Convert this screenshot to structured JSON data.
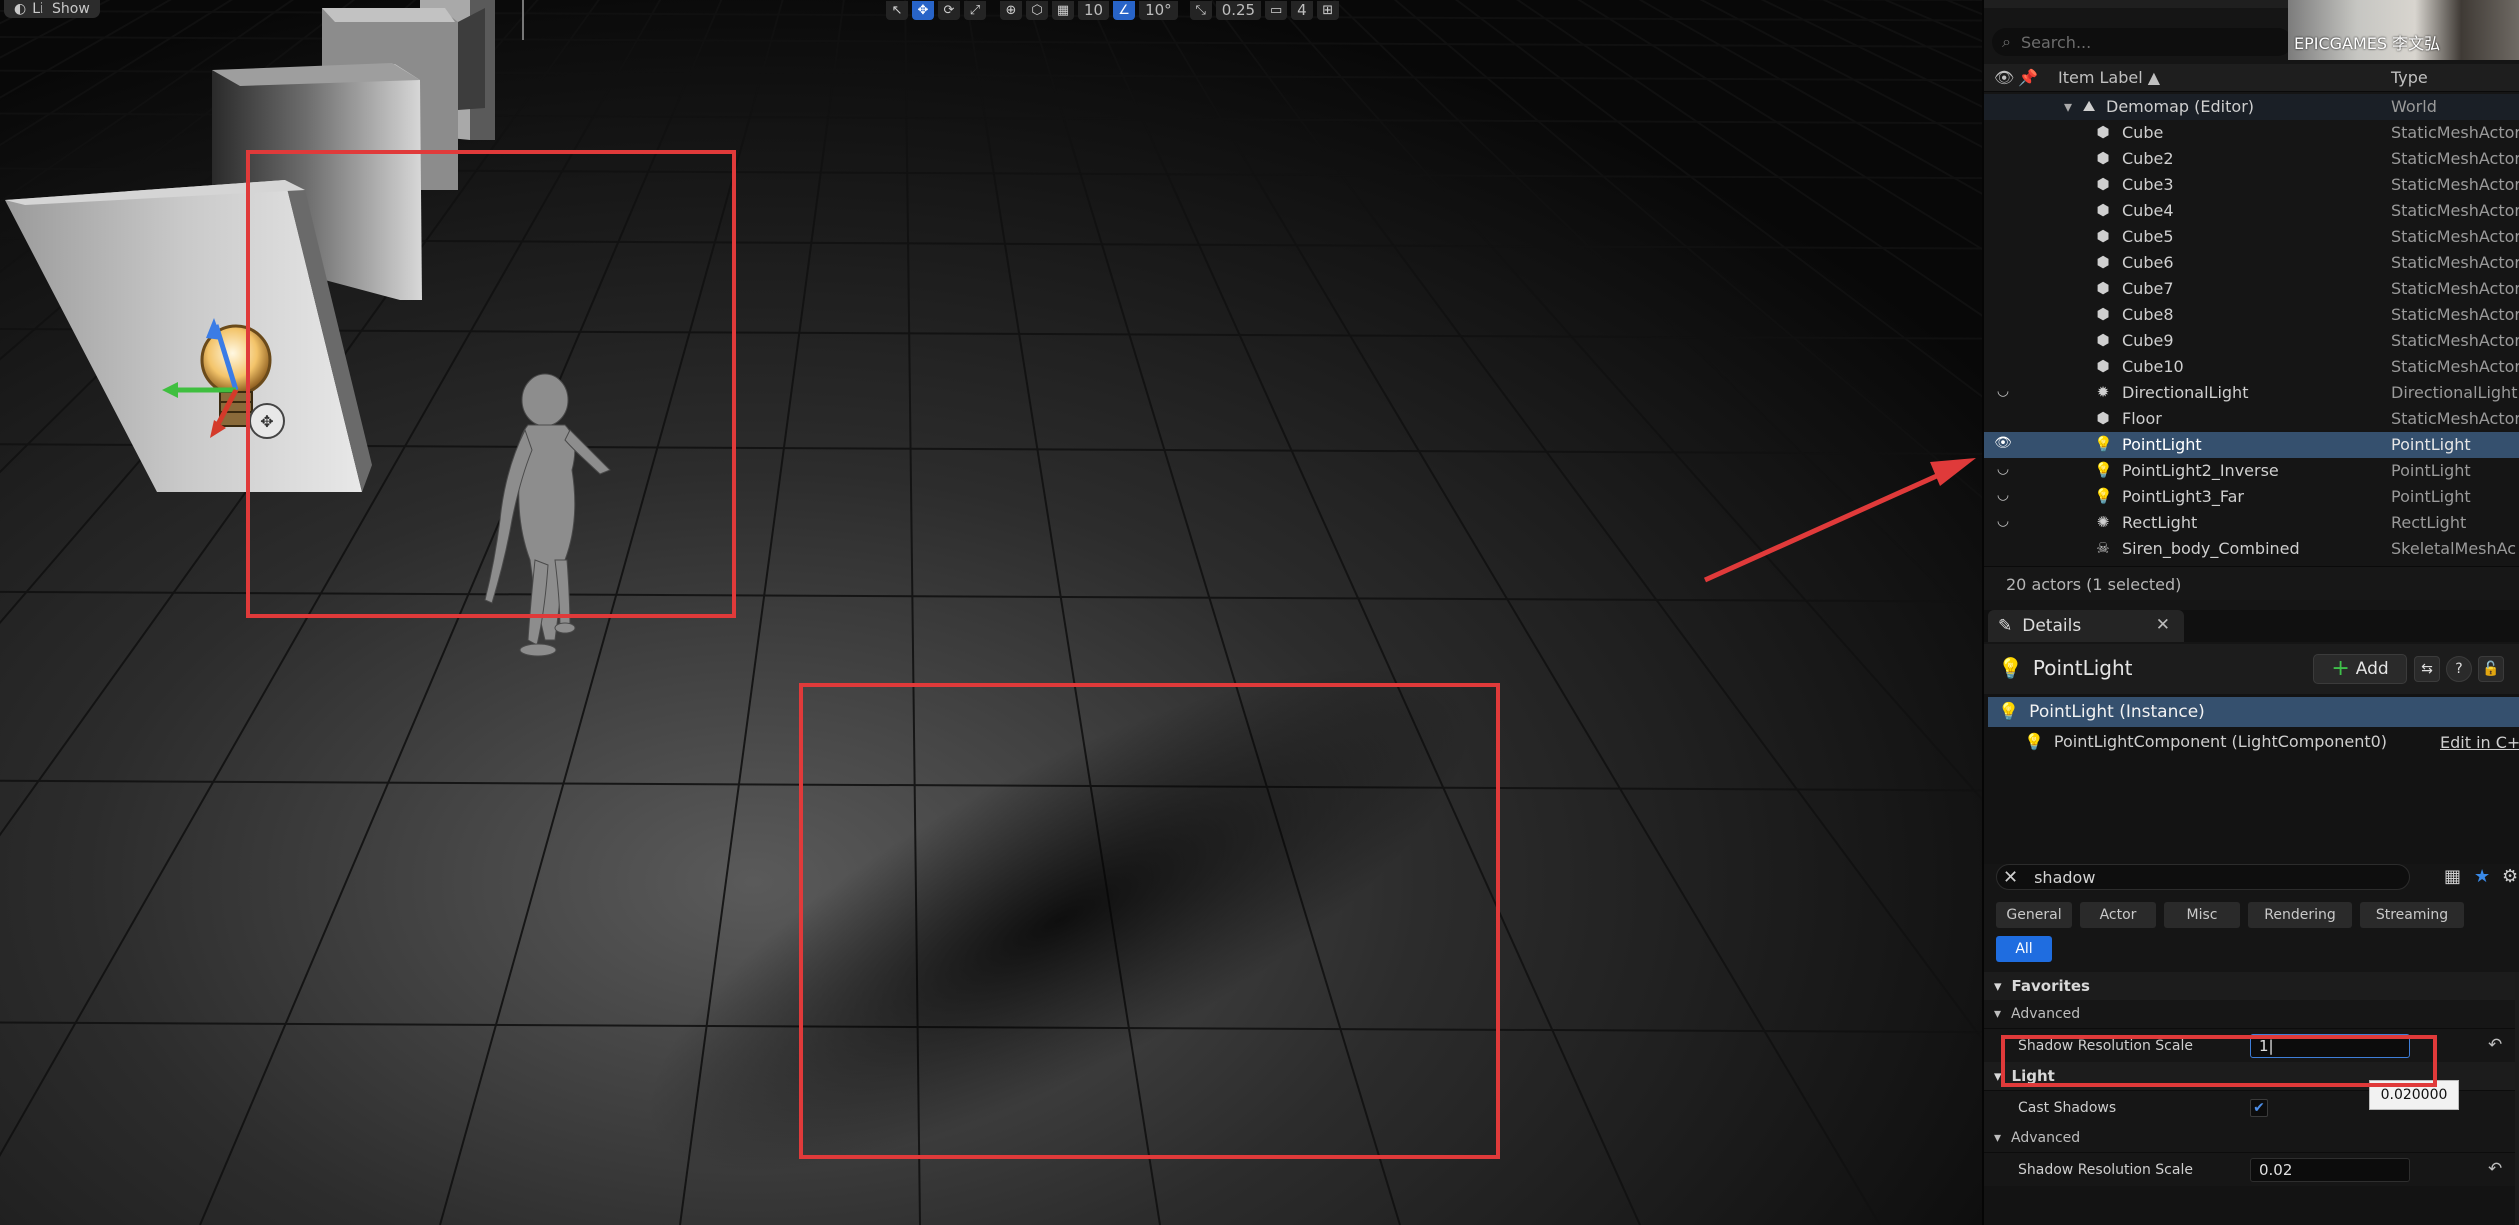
{
  "viewport": {
    "lit_label": "Lit",
    "show_label": "Show",
    "grid_value": "10",
    "rotation_value": "10°",
    "scale_value": "0.25",
    "camera_value": "4"
  },
  "outliner": {
    "search_placeholder": "Search...",
    "col_label": "Item Label ▲",
    "col_type": "Type",
    "items": [
      {
        "label": "Demomap (Editor)",
        "type": "World",
        "icon": "world-icon"
      },
      {
        "label": "Cube",
        "type": "StaticMeshActor",
        "icon": "cube-icon"
      },
      {
        "label": "Cube2",
        "type": "StaticMeshActor",
        "icon": "cube-icon"
      },
      {
        "label": "Cube3",
        "type": "StaticMeshActor",
        "icon": "cube-icon"
      },
      {
        "label": "Cube4",
        "type": "StaticMeshActor",
        "icon": "cube-icon"
      },
      {
        "label": "Cube5",
        "type": "StaticMeshActor",
        "icon": "cube-icon"
      },
      {
        "label": "Cube6",
        "type": "StaticMeshActor",
        "icon": "cube-icon"
      },
      {
        "label": "Cube7",
        "type": "StaticMeshActor",
        "icon": "cube-icon"
      },
      {
        "label": "Cube8",
        "type": "StaticMeshActor",
        "icon": "cube-icon"
      },
      {
        "label": "Cube9",
        "type": "StaticMeshActor",
        "icon": "cube-icon"
      },
      {
        "label": "Cube10",
        "type": "StaticMeshActor",
        "icon": "cube-icon"
      },
      {
        "label": "DirectionalLight",
        "type": "DirectionalLight",
        "icon": "sun-icon"
      },
      {
        "label": "Floor",
        "type": "StaticMeshActor",
        "icon": "cube-icon"
      },
      {
        "label": "PointLight",
        "type": "PointLight",
        "icon": "lightbulb-icon"
      },
      {
        "label": "PointLight2_Inverse",
        "type": "PointLight",
        "icon": "lightbulb-icon"
      },
      {
        "label": "PointLight3_Far",
        "type": "PointLight",
        "icon": "lightbulb-icon"
      },
      {
        "label": "RectLight",
        "type": "RectLight",
        "icon": "rectlight-icon"
      },
      {
        "label": "Siren_body_Combined",
        "type": "SkeletalMeshAc",
        "icon": "skeleton-icon"
      }
    ],
    "status": "20 actors (1 selected)"
  },
  "details": {
    "tab_label": "Details",
    "actor_name": "PointLight",
    "add_label": "Add",
    "instance_label": "PointLight (Instance)",
    "component_label": "PointLightComponent (LightComponent0)",
    "edit_link": "Edit in C++",
    "search_value": "shadow",
    "categories": [
      "General",
      "Actor",
      "Misc",
      "Rendering",
      "Streaming"
    ],
    "category_all": "All",
    "sections": {
      "favorites": "Favorites",
      "advanced1": "Advanced",
      "light": "Light",
      "advanced2": "Advanced"
    },
    "props": {
      "shadow_res_label": "Shadow Resolution Scale",
      "shadow_res_value_editing": "1|",
      "tooltip_value": "0.020000",
      "cast_shadows_label": "Cast Shadows",
      "shadow_res_label_2": "Shadow Resolution Scale",
      "shadow_res_value_2": "0.02"
    }
  },
  "webcam": {
    "watermark": "EPICGAMES 李文弘"
  },
  "colors": {
    "selection": "#35506e",
    "accent_blue": "#1f6de0",
    "annotation_red": "#e03a3a"
  }
}
